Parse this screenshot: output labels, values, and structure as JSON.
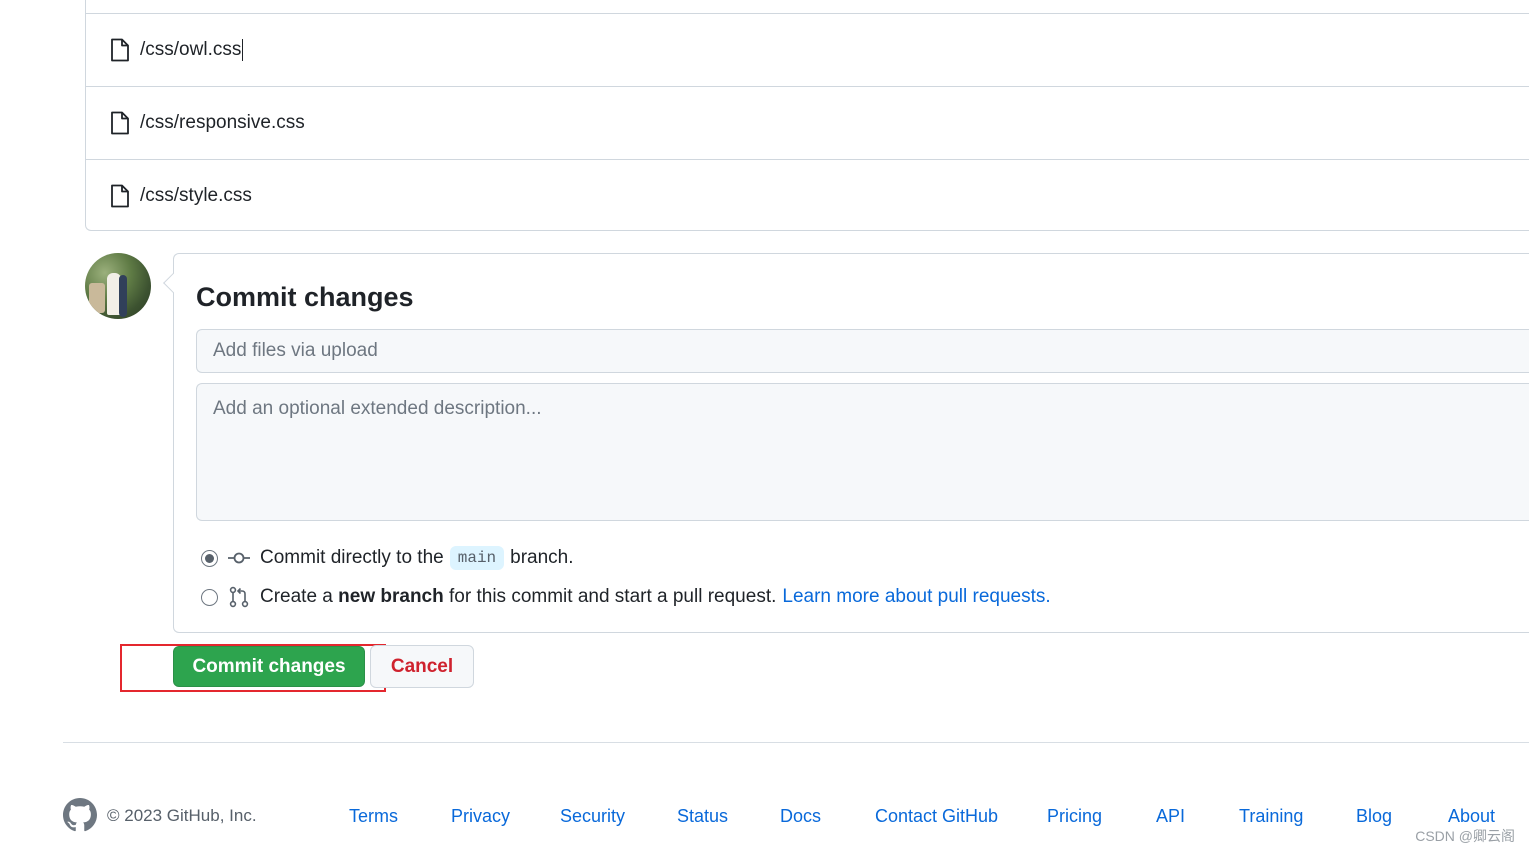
{
  "files": [
    {
      "name": "/css/owl.css"
    },
    {
      "name": "/css/responsive.css"
    },
    {
      "name": "/css/style.css"
    }
  ],
  "commit": {
    "title": "Commit changes",
    "summary_placeholder": "Add files via upload",
    "description_placeholder": "Add an optional extended description...",
    "option_direct": {
      "prefix": "Commit directly to the",
      "branch": "main",
      "suffix": "branch.",
      "checked": true
    },
    "option_new_branch": {
      "prefix": "Create a",
      "bold": "new branch",
      "suffix": "for this commit and start a pull request.",
      "link": "Learn more about pull requests.",
      "checked": false
    },
    "submit_label": "Commit changes",
    "cancel_label": "Cancel"
  },
  "footer": {
    "copyright": "© 2023 GitHub, Inc.",
    "links": [
      "Terms",
      "Privacy",
      "Security",
      "Status",
      "Docs",
      "Contact GitHub",
      "Pricing",
      "API",
      "Training",
      "Blog",
      "About"
    ]
  },
  "watermark": "CSDN @卿云阁",
  "colors": {
    "primary_button": "#2da44e",
    "danger_text": "#cf222e",
    "link": "#0969da",
    "highlight_box": "#e4272e"
  },
  "icons": {
    "file": "file-icon",
    "commit": "git-commit-icon",
    "pull_request": "git-pull-request-icon",
    "github": "github-mark-icon"
  }
}
